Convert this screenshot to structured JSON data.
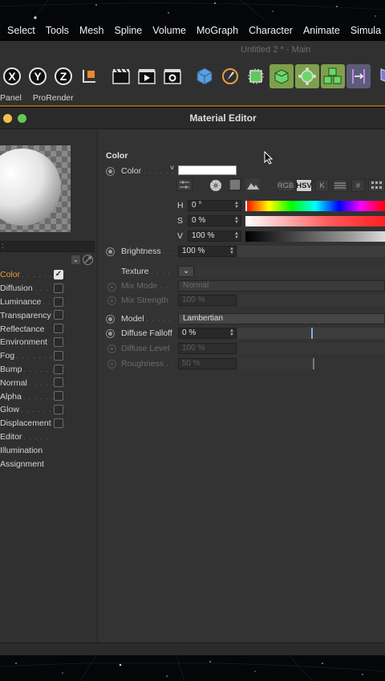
{
  "menubar": {
    "items": [
      "Select",
      "Tools",
      "Mesh",
      "Spline",
      "Volume",
      "MoGraph",
      "Character",
      "Animate",
      "Simula"
    ]
  },
  "c4d": {
    "document_title": "Untitled 2 * - Main",
    "tabs": [
      "Panel",
      "ProRender"
    ],
    "axis_buttons": [
      "X",
      "Y",
      "Z"
    ]
  },
  "material_editor": {
    "window_title": "Material Editor",
    "channels": [
      {
        "label": "Color",
        "dots": ". . . . . .",
        "checkbox": true,
        "checked": true,
        "active": true
      },
      {
        "label": "Diffusion",
        "dots": ". . .",
        "checkbox": true,
        "checked": false
      },
      {
        "label": "Luminance",
        "dots": ". .",
        "checkbox": true,
        "checked": false
      },
      {
        "label": "Transparency",
        "dots": "",
        "checkbox": true,
        "checked": false
      },
      {
        "label": "Reflectance",
        "dots": "",
        "checkbox": true,
        "checked": false
      },
      {
        "label": "Environment",
        "dots": "",
        "checkbox": true,
        "checked": false
      },
      {
        "label": "Fog",
        "dots": ". . . . . . . .",
        "checkbox": true,
        "checked": false
      },
      {
        "label": "Bump",
        "dots": ". . . . . . .",
        "checkbox": true,
        "checked": false
      },
      {
        "label": "Normal",
        "dots": ". . . . . .",
        "checkbox": true,
        "checked": false
      },
      {
        "label": "Alpha",
        "dots": ". . . . . . .",
        "checkbox": true,
        "checked": false
      },
      {
        "label": "Glow",
        "dots": ". . . . . . .",
        "checkbox": true,
        "checked": false
      },
      {
        "label": "Displacement",
        "dots": "",
        "checkbox": true,
        "checked": false
      },
      {
        "label": "Editor",
        "dots": ". . . . .",
        "checkbox": false
      },
      {
        "label": "Illumination",
        "dots": "",
        "checkbox": false
      },
      {
        "label": "Assignment",
        "dots": "",
        "checkbox": false
      }
    ],
    "section_title": "Color",
    "color": {
      "label": "Color",
      "dots": ". . . . . .",
      "swatch_color": "#ffffff",
      "modes": [
        "RGB",
        "HSV",
        "K"
      ],
      "active_mode": "HSV",
      "h_label": "H",
      "h_value": "0 °",
      "s_label": "S",
      "s_value": "0 %",
      "v_label": "V",
      "v_value": "100 %"
    },
    "brightness": {
      "label": "Brightness",
      "dots": ". .",
      "value": "100 %"
    },
    "texture": {
      "label": "Texture",
      "dots": ". . . ."
    },
    "mix_mode": {
      "label": "Mix Mode",
      "dots": ". . .",
      "value": "Normal"
    },
    "mix_strength": {
      "label": "Mix Strength",
      "value": "100 %"
    },
    "model": {
      "label": "Model",
      "dots": ". . . . .",
      "value": "Lambertian"
    },
    "diffuse_falloff": {
      "label": "Diffuse Falloff",
      "value": "0 %",
      "level": 0.5
    },
    "diffuse_level": {
      "label": "Diffuse Level",
      "value": "100 %"
    },
    "roughness": {
      "label": "Roughness",
      "dots": ". . .",
      "value": "50 %",
      "level": 0.5
    }
  }
}
